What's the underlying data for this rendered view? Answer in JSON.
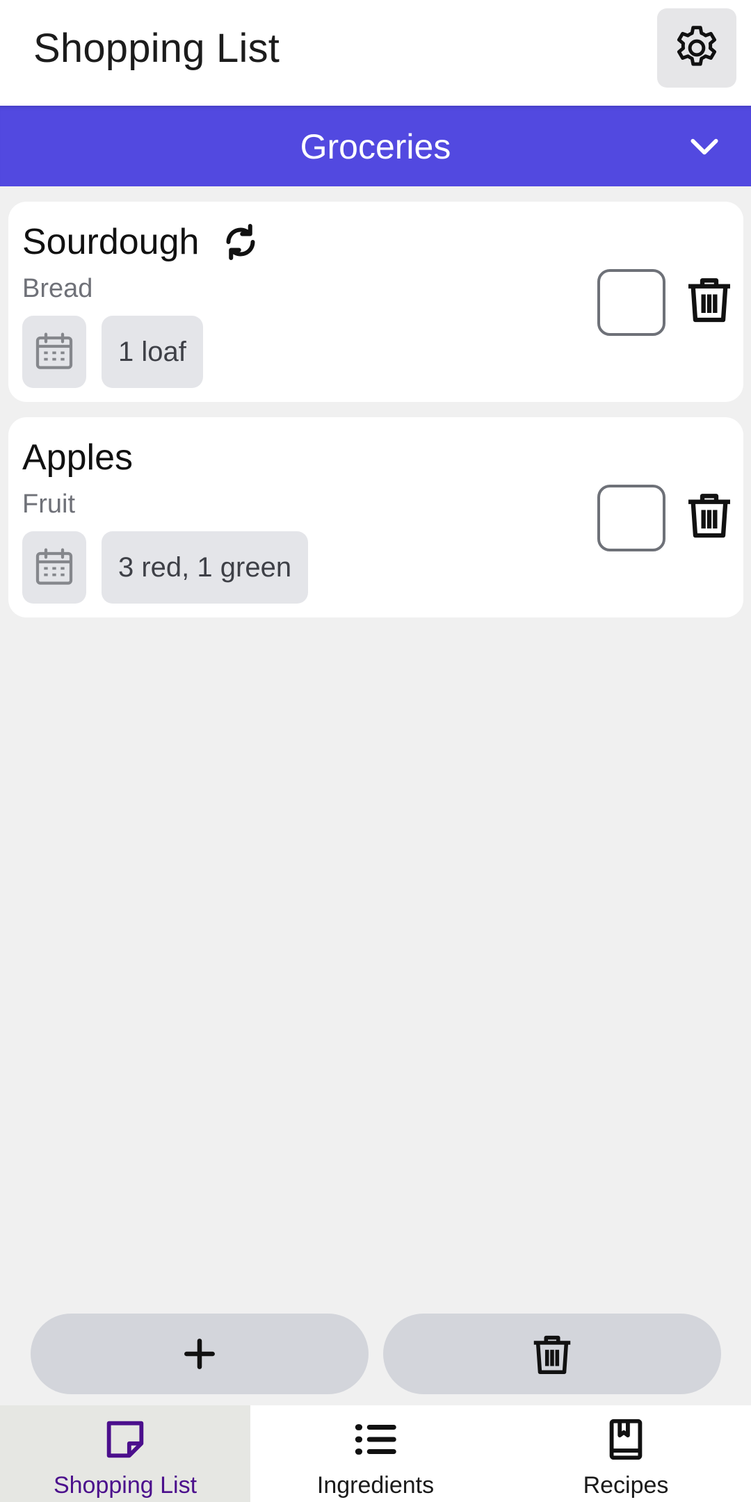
{
  "header": {
    "title": "Shopping List",
    "settings_icon": "gear-icon"
  },
  "category": {
    "selected": "Groceries",
    "icon": "chevron-down-icon"
  },
  "items": [
    {
      "name": "Sourdough",
      "category": "Bread",
      "quantity": "1 loaf",
      "recurring": true,
      "checked": false
    },
    {
      "name": "Apples",
      "category": "Fruit",
      "quantity": "3 red, 1 green",
      "recurring": false,
      "checked": false
    }
  ],
  "actions": {
    "add_icon": "plus-icon",
    "clear_icon": "trash-icon"
  },
  "nav": {
    "items": [
      {
        "label": "Shopping List",
        "icon": "note-icon",
        "active": true
      },
      {
        "label": "Ingredients",
        "icon": "list-icon",
        "active": false
      },
      {
        "label": "Recipes",
        "icon": "book-icon",
        "active": false
      }
    ]
  },
  "colors": {
    "accent": "#5249e0",
    "active_nav_text": "#4b0f8c",
    "background": "#f0f0f0",
    "chip": "#e4e5e9"
  }
}
